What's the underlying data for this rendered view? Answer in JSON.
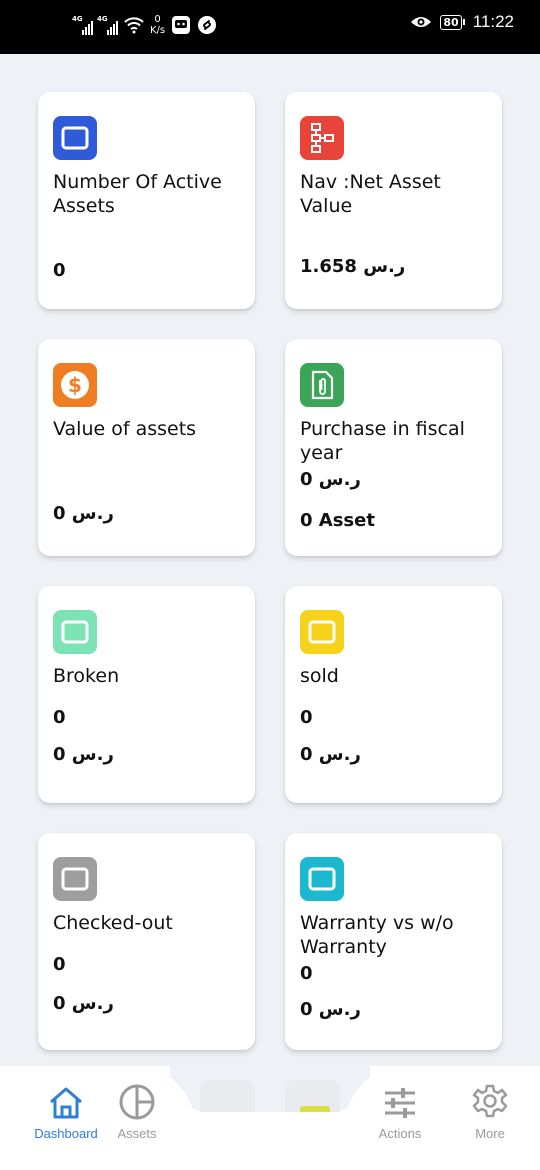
{
  "status_bar": {
    "network_1": "4G",
    "network_2": "4G",
    "speed_value": "0",
    "speed_unit": "K/s",
    "battery": "80",
    "time": "11:22"
  },
  "cards": [
    {
      "title": "Number Of Active Assets",
      "values": [
        "0"
      ],
      "icon_color": "#2f5bd9",
      "icon": "window-icon"
    },
    {
      "title": "Nav :Net Asset Value",
      "values": [
        "1.658 ر.س"
      ],
      "icon_color": "#e8443a",
      "icon": "hierarchy-icon"
    },
    {
      "title": "Value of assets",
      "values": [
        "0 ر.س"
      ],
      "icon_color": "#ef7d22",
      "icon": "dollar-icon"
    },
    {
      "title": "Purchase in fiscal year",
      "values": [
        "0 ر.س",
        "0 Asset"
      ],
      "icon_color": "#3aa557",
      "icon": "paperclip-icon"
    },
    {
      "title": "Broken",
      "values": [
        "0",
        "0 ر.س"
      ],
      "icon_color": "#7be3b5",
      "icon": "window-icon"
    },
    {
      "title": "sold",
      "values": [
        "0",
        "0 ر.س"
      ],
      "icon_color": "#f7d21b",
      "icon": "window-icon"
    },
    {
      "title": "Checked-out",
      "values": [
        "0",
        "0 ر.س"
      ],
      "icon_color": "#9e9e9e",
      "icon": "window-icon"
    },
    {
      "title": "Warranty vs w/o Warranty",
      "values": [
        "0",
        "0 ر.س"
      ],
      "icon_color": "#1cb8cf",
      "icon": "window-icon"
    }
  ],
  "nav": {
    "dashboard": "Dashboard",
    "assets": "Assets",
    "actions": "Actions",
    "more": "More",
    "active_color": "#2c7fd4",
    "inactive_color": "#9a9a9a"
  }
}
